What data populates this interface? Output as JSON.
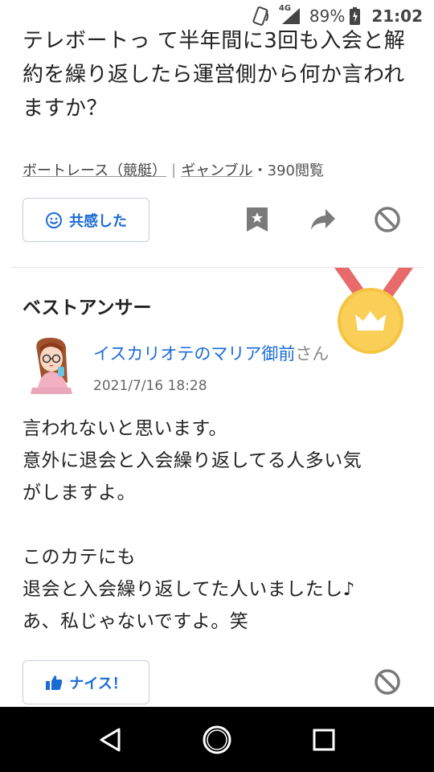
{
  "status": {
    "network": "4G",
    "battery": "89%",
    "time": "21:02"
  },
  "question": {
    "lines": [
      "テレボートっ  て半年間に3回も入会と解",
      "約を繰り返したら運営側から何か言われ",
      "ますか？"
    ]
  },
  "meta": {
    "category1": "ボートレース（競艇）",
    "separator": "|",
    "category2": "ギャンブル",
    "views": "・390閲覧"
  },
  "actions": {
    "empathy_label": "共感した",
    "nice_label": "ナイス！"
  },
  "best_answer": {
    "heading": "ベストアンサー",
    "user_name": "イスカリオテのマリア御前",
    "honorific": "さん",
    "date": "2021/7/16 18:28",
    "lines": [
      "言われないと思います。",
      "意外に退会と入会繰り返してる人多い気",
      "がしますよ。",
      "",
      "このカテにも",
      "退会と入会繰り返してた人いましたし♪",
      "あ、私じゃないですよ。笑"
    ]
  },
  "colors": {
    "accent": "#1b6bd6",
    "medal_ribbon": "#e86a6a",
    "medal_gold": "#f5c542"
  },
  "icons": [
    "nfc-icon",
    "signal-icon",
    "battery-icon",
    "smile-icon",
    "bookmark-icon",
    "share-icon",
    "block-icon",
    "thumbs-up-icon",
    "back-icon",
    "home-icon",
    "recents-icon",
    "crown-medal-icon"
  ]
}
